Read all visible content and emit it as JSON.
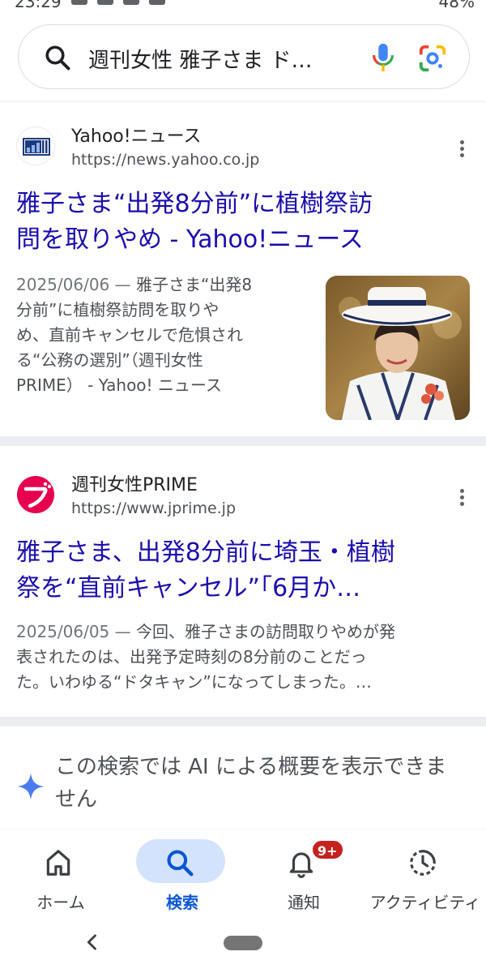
{
  "status_bar": {
    "time": "23:29",
    "battery": "48%"
  },
  "search": {
    "query": "週刊女性 雅子さま ド…"
  },
  "results": [
    {
      "site_name": "Yahoo!ニュース",
      "url": "https://news.yahoo.co.jp",
      "title_line1": "雅子さま“出発8分前”に植樹祭訪",
      "title_line2": "問を取りやめ - Yahoo!ニュース",
      "date": "2025/06/06 —",
      "snippet_line1": "雅子さま“出発8",
      "snippet_line2": "分前”に植樹祭訪問を取りや",
      "snippet_line3": "め、直前キャンセルで危惧され",
      "snippet_line4": "る“公務の選別”（週刊女性",
      "snippet_line5": "PRIME） - Yahoo! ニュース"
    },
    {
      "site_name": "週刊女性PRIME",
      "url": "https://www.jprime.jp",
      "title_line1": "雅子さま、出発8分前に埼玉・植樹",
      "title_line2": "祭を“直前キャンセル”「6月か…",
      "date": "2025/06/05 —",
      "snippet_line1": "今回、雅子さまの訪問取りやめが発",
      "snippet_line2": "表されたのは、出発予定時刻の8分前のことだっ",
      "snippet_line3": "た。いわゆる“ドタキャン”になってしまった。…"
    }
  ],
  "ai_note": {
    "line1": "この検索では AI による概要を表示できま",
    "line2": "せん"
  },
  "bottom_nav": {
    "items": [
      {
        "label": "ホーム",
        "icon": "home-icon"
      },
      {
        "label": "検索",
        "icon": "search-icon"
      },
      {
        "label": "通知",
        "icon": "bell-icon",
        "badge": "9+"
      },
      {
        "label": "アクティビティ",
        "icon": "activity-icon"
      }
    ],
    "active_index": 1
  },
  "colors": {
    "link": "#1a0dab",
    "active_tab": "#0b57d0",
    "active_pill": "#d3e3fd",
    "badge": "#c5221f"
  }
}
